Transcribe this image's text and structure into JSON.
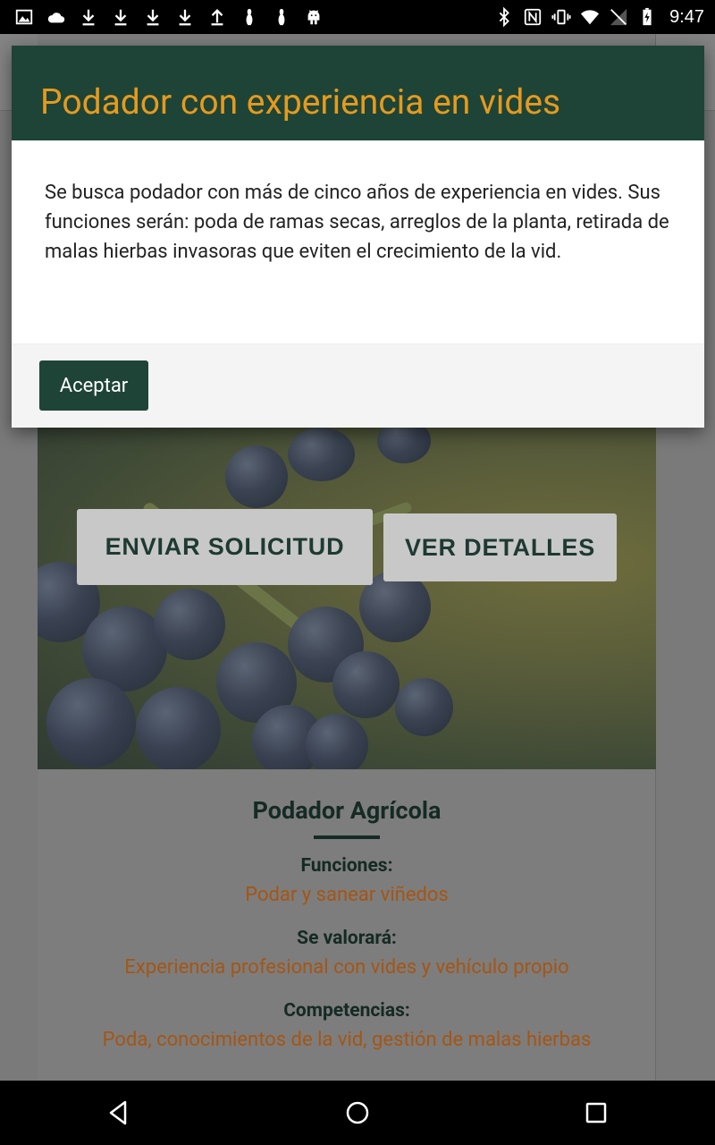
{
  "status_bar": {
    "time": "9:47",
    "left_icons": [
      "image-icon",
      "cloud-icon",
      "download-icon",
      "download-icon",
      "download-icon",
      "download-icon",
      "upload-icon",
      "bowling-pin-icon",
      "bowling-pin-icon",
      "android-icon"
    ],
    "right_icons": [
      "bluetooth-icon",
      "nfc-icon",
      "vibrate-icon",
      "wifi-icon",
      "no-signal-icon",
      "battery-charging-icon"
    ]
  },
  "dialog": {
    "title": "Podador con experiencia en vides",
    "body": "Se busca podador con más de cinco años de experiencia en vides. Sus funciones serán: poda de ramas secas, arreglos de la planta, retirada de malas hierbas invasoras que eviten el crecimiento de la vid.",
    "accept_label": "Aceptar"
  },
  "hero": {
    "send_label": "ENVIAR SOLICITUD",
    "details_label": "VER DETALLES"
  },
  "job": {
    "title": "Podador Agrícola",
    "sections": [
      {
        "label": "Funciones:",
        "value": "Podar y sanear viñedos"
      },
      {
        "label": "Se valorará:",
        "value": "Experiencia profesional con vides y vehículo propio"
      },
      {
        "label": "Competencias:",
        "value": "Poda, conocimientos de la vid, gestión de malas hierbas"
      }
    ]
  },
  "colors": {
    "primary": "#1e4437",
    "accent": "#e59a1e",
    "value_text": "#a45615"
  }
}
